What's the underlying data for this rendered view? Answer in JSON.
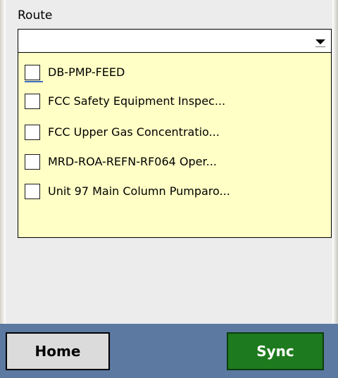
{
  "route": {
    "label": "Route",
    "selected_value": ""
  },
  "routes_list": [
    {
      "label": "DB-PMP-FEED",
      "checked": false
    },
    {
      "label": "FCC Safety Equipment Inspec...",
      "checked": false
    },
    {
      "label": "FCC Upper Gas Concentratio...",
      "checked": false
    },
    {
      "label": "MRD-ROA-REFN-RF064 Oper...",
      "checked": false
    },
    {
      "label": "Unit 97 Main Column Pumparo...",
      "checked": false
    }
  ],
  "bottom_bar": {
    "home_label": "Home",
    "sync_label": "Sync"
  },
  "colors": {
    "list_background": "#ffffc6",
    "bottom_bar": "#5b79a1",
    "sync_button": "#1e7a1e",
    "home_button": "#dbdbdb"
  }
}
